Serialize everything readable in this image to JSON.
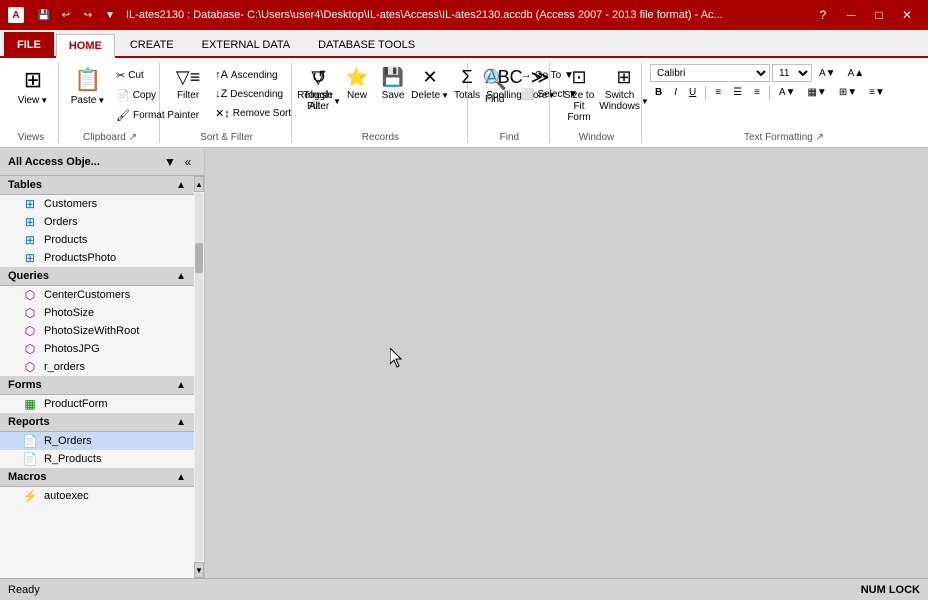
{
  "titlebar": {
    "logo": "A",
    "title": "IL-ates2130 : Database- C:\\Users\\user4\\Desktop\\IL-ates\\Access\\IL-ates2130.accdb (Access 2007 - 2013 file format) - Ac...",
    "help_btn": "?",
    "min_btn": "─",
    "max_btn": "□",
    "close_btn": "✕"
  },
  "quickaccess": {
    "save": "💾",
    "undo": "↩",
    "redo": "↪",
    "dropdown": "▼"
  },
  "tabs": [
    {
      "label": "FILE",
      "active": false
    },
    {
      "label": "HOME",
      "active": true
    },
    {
      "label": "CREATE",
      "active": false
    },
    {
      "label": "EXTERNAL DATA",
      "active": false
    },
    {
      "label": "DATABASE TOOLS",
      "active": false
    }
  ],
  "ribbon": {
    "groups": [
      {
        "name": "views",
        "label": "Views",
        "items": [
          {
            "type": "large",
            "icon": "⊞",
            "label": "View",
            "has_arrow": true
          }
        ]
      },
      {
        "name": "clipboard",
        "label": "Clipboard",
        "items": [
          {
            "type": "large",
            "icon": "📋",
            "label": "Paste",
            "has_arrow": true
          },
          {
            "type": "small",
            "icon": "✂",
            "label": "Cut"
          },
          {
            "type": "small",
            "icon": "📄",
            "label": "Copy"
          },
          {
            "type": "small",
            "icon": "🖌",
            "label": "Format Painter"
          }
        ]
      },
      {
        "name": "sort_filter",
        "label": "Sort & Filter",
        "items": [
          {
            "type": "large",
            "icon": "▼≡",
            "label": "Filter",
            "has_arrow": false
          },
          {
            "type": "small",
            "icon": "↑",
            "label": "Ascending"
          },
          {
            "type": "small",
            "icon": "↓",
            "label": "Descending"
          },
          {
            "type": "small",
            "icon": "✕",
            "label": "Remove Sort"
          },
          {
            "type": "large_sm",
            "icon": "▼",
            "label": "Toggle Filter",
            "has_arrow": true
          }
        ]
      },
      {
        "name": "records",
        "label": "Records",
        "items": [
          {
            "type": "large",
            "icon": "↺",
            "label": "Refresh\nAll",
            "has_arrow": true
          },
          {
            "type": "large",
            "icon": "➕",
            "label": "New"
          },
          {
            "type": "large",
            "icon": "💾",
            "label": "Save"
          },
          {
            "type": "large",
            "icon": "✕",
            "label": "Delete",
            "has_arrow": true
          },
          {
            "type": "large",
            "icon": "∑",
            "label": "Totals"
          },
          {
            "type": "large",
            "icon": "ABC",
            "label": "Spelling"
          },
          {
            "type": "large",
            "icon": "≡",
            "label": "More",
            "has_arrow": true
          }
        ]
      },
      {
        "name": "find",
        "label": "Find",
        "items": [
          {
            "type": "large",
            "icon": "🔍",
            "label": "Find",
            "has_arrow": false
          },
          {
            "type": "large",
            "icon": "→",
            "label": "Go To",
            "has_arrow": true
          },
          {
            "type": "large",
            "icon": "abc",
            "label": "Select",
            "has_arrow": true
          }
        ]
      },
      {
        "name": "window",
        "label": "Window",
        "items": [
          {
            "type": "large",
            "icon": "⊡",
            "label": "Size to\nFit Form"
          },
          {
            "type": "large",
            "icon": "⊞",
            "label": "Switch\nWindows",
            "has_arrow": true
          }
        ]
      },
      {
        "name": "text_formatting",
        "label": "Text Formatting",
        "font_name": "Calibri",
        "font_size": "11",
        "bold": "B",
        "italic": "I",
        "underline": "U",
        "align_left": "≡",
        "align_center": "≡",
        "align_right": "≡"
      }
    ]
  },
  "nav": {
    "title": "All Access Obje...",
    "sections": [
      {
        "name": "Tables",
        "items": [
          {
            "name": "Customers",
            "icon": "table",
            "selected": false
          },
          {
            "name": "Orders",
            "icon": "table",
            "selected": false
          },
          {
            "name": "Products",
            "icon": "table",
            "selected": false
          },
          {
            "name": "ProductsPhoto",
            "icon": "table",
            "selected": false
          }
        ]
      },
      {
        "name": "Queries",
        "items": [
          {
            "name": "CenterCustomers",
            "icon": "query",
            "selected": false
          },
          {
            "name": "PhotoSize",
            "icon": "query",
            "selected": false
          },
          {
            "name": "PhotoSizeWithRoot",
            "icon": "query",
            "selected": false
          },
          {
            "name": "PhotosJPG",
            "icon": "query",
            "selected": false
          },
          {
            "name": "r_orders",
            "icon": "query",
            "selected": false
          }
        ]
      },
      {
        "name": "Forms",
        "items": [
          {
            "name": "ProductForm",
            "icon": "form",
            "selected": false
          }
        ]
      },
      {
        "name": "Reports",
        "items": [
          {
            "name": "R_Orders",
            "icon": "report",
            "selected": true
          },
          {
            "name": "R_Products",
            "icon": "report",
            "selected": false
          }
        ]
      },
      {
        "name": "Macros",
        "items": [
          {
            "name": "autoexec",
            "icon": "macro",
            "selected": false
          }
        ]
      }
    ]
  },
  "status": {
    "left": "Ready",
    "right": "NUM LOCK"
  }
}
